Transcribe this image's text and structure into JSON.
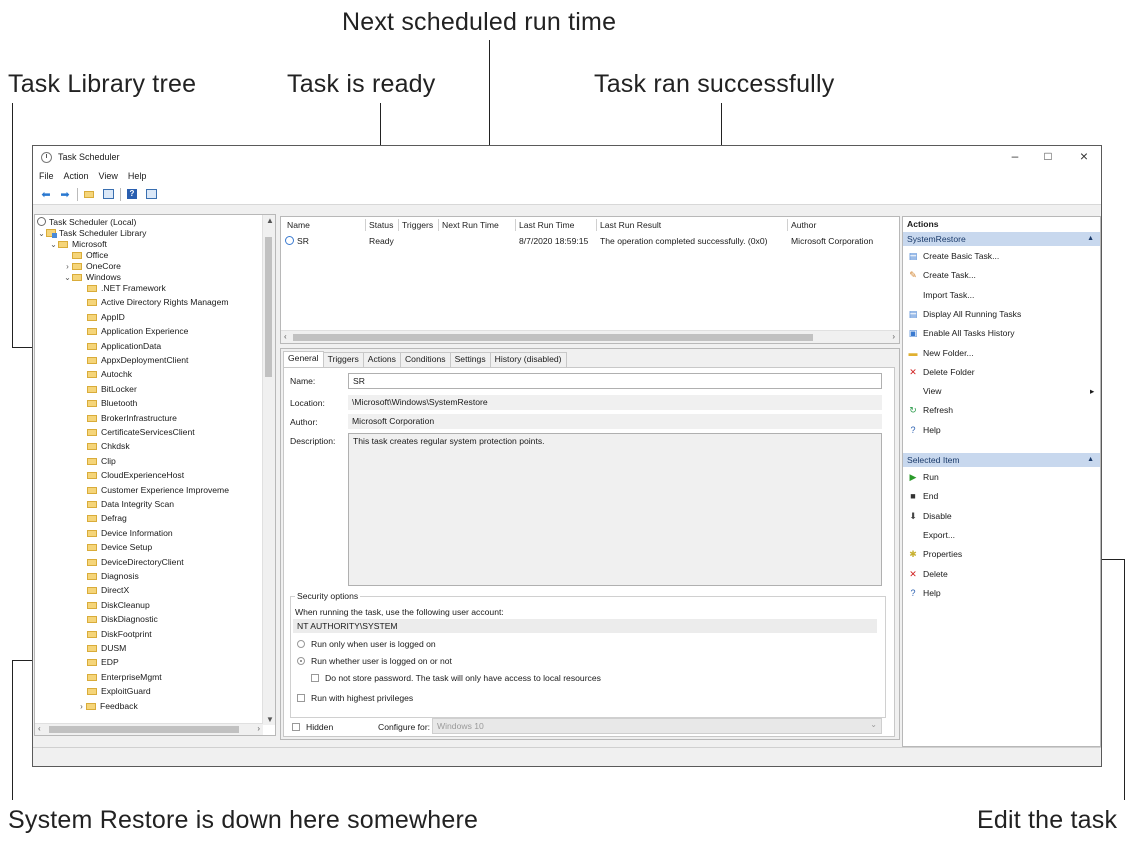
{
  "callouts": {
    "next_run": "Next scheduled run time",
    "tree": "Task Library tree",
    "ready": "Task is ready",
    "success": "Task ran successfully",
    "restore": "System Restore is down here somewhere",
    "edit": "Edit the task"
  },
  "window": {
    "title": "Task Scheduler",
    "minimize": "–",
    "maximize": "□",
    "close": "×",
    "menu": [
      "File",
      "Action",
      "View",
      "Help"
    ]
  },
  "tree": {
    "root": "Task Scheduler (Local)",
    "library": "Task Scheduler Library",
    "microsoft": "Microsoft",
    "level2": [
      "Office",
      "OneCore",
      "Windows"
    ],
    "windows_children": [
      ".NET Framework",
      "Active Directory Rights Managem",
      "AppID",
      "Application Experience",
      "ApplicationData",
      "AppxDeploymentClient",
      "Autochk",
      "BitLocker",
      "Bluetooth",
      "BrokerInfrastructure",
      "CertificateServicesClient",
      "Chkdsk",
      "Clip",
      "CloudExperienceHost",
      "Customer Experience Improveme",
      "Data Integrity Scan",
      "Defrag",
      "Device Information",
      "Device Setup",
      "DeviceDirectoryClient",
      "Diagnosis",
      "DirectX",
      "DiskCleanup",
      "DiskDiagnostic",
      "DiskFootprint",
      "DUSM",
      "EDP",
      "EnterpriseMgmt",
      "ExploitGuard",
      "Feedback"
    ]
  },
  "task_list": {
    "columns": [
      "Name",
      "Status",
      "Triggers",
      "Next Run Time",
      "Last Run Time",
      "Last Run Result",
      "Author"
    ],
    "row": {
      "name": "SR",
      "status": "Ready",
      "triggers": "",
      "next_run": "",
      "last_run": "8/7/2020 18:59:15",
      "result": "The operation completed successfully. (0x0)",
      "author": "Microsoft Corporation"
    }
  },
  "detail": {
    "tabs": [
      "General",
      "Triggers",
      "Actions",
      "Conditions",
      "Settings",
      "History (disabled)"
    ],
    "name_label": "Name:",
    "name_value": "SR",
    "location_label": "Location:",
    "location_value": "\\Microsoft\\Windows\\SystemRestore",
    "author_label": "Author:",
    "author_value": "Microsoft Corporation",
    "description_label": "Description:",
    "description_value": "This task creates regular system protection points.",
    "security_title": "Security options",
    "security_prompt": "When running the task, use the following user account:",
    "account": "NT AUTHORITY\\SYSTEM",
    "radio1": "Run only when user is logged on",
    "radio2": "Run whether user is logged on or not",
    "no_store": "Do not store password.  The task will only have access to local resources",
    "highest": "Run with highest privileges",
    "hidden": "Hidden",
    "configure_label": "Configure for:",
    "configure_value": "Windows 10"
  },
  "actions": {
    "header": "Actions",
    "section1": "SystemRestore",
    "items1": [
      "Create Basic Task...",
      "Create Task...",
      "Import Task...",
      "Display All Running Tasks",
      "Enable All Tasks History",
      "New Folder...",
      "Delete Folder",
      "View",
      "Refresh",
      "Help"
    ],
    "section2": "Selected Item",
    "items2": [
      "Run",
      "End",
      "Disable",
      "Export...",
      "Properties",
      "Delete",
      "Help"
    ]
  }
}
